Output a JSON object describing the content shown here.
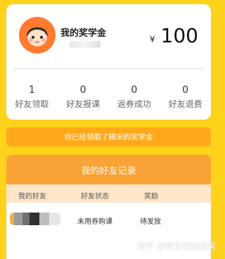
{
  "summary": {
    "title": "我的奖学金",
    "currency": "¥",
    "amount": "100",
    "stats": [
      {
        "value": "1",
        "label": "好友领取"
      },
      {
        "value": "0",
        "label": "好友报课"
      },
      {
        "value": "0",
        "label": "返券成功"
      },
      {
        "value": "0",
        "label": "好友退费"
      }
    ]
  },
  "banner": {
    "text": "你已经领取了精米的奖学金"
  },
  "records": {
    "title": "我的好友记录",
    "columns": [
      "我的好友",
      "好友状态",
      "奖励"
    ],
    "rows": [
      {
        "status": "未用券购课",
        "reward": "待发放"
      }
    ]
  },
  "watermark": "知乎 @野生的独孤菌"
}
